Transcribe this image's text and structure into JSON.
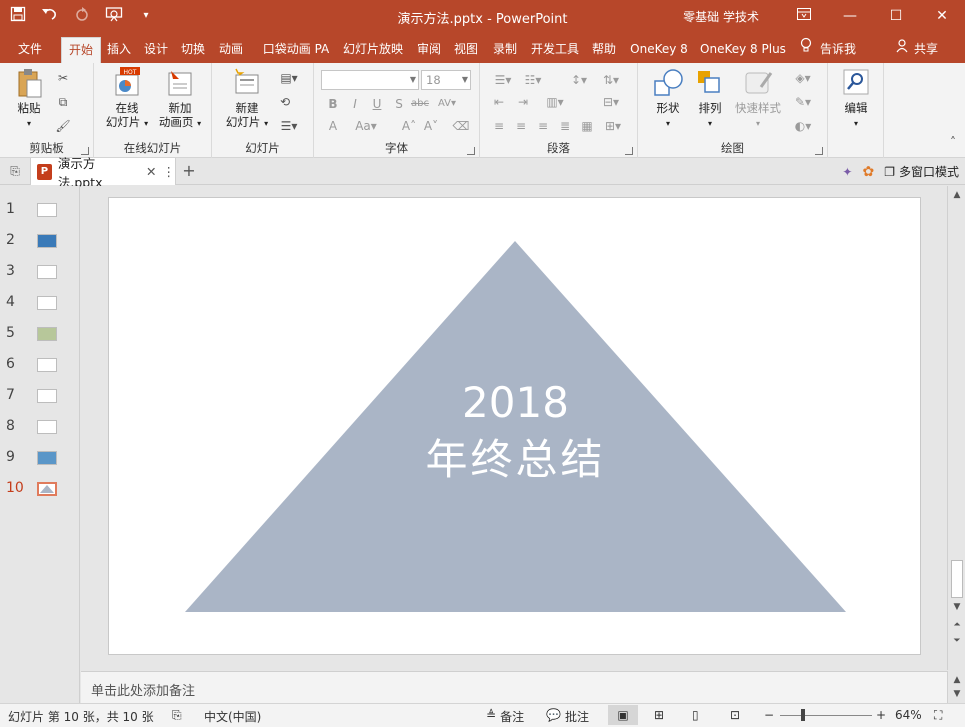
{
  "window": {
    "title": "演示方法.pptx  -  PowerPoint",
    "user": "零基础 学技术",
    "qat_icons": [
      "save-icon",
      "undo-icon",
      "redo-icon",
      "start-from-beginning-icon",
      "customize-qat-icon"
    ]
  },
  "tabs": [
    {
      "label": "文件"
    },
    {
      "label": "开始"
    },
    {
      "label": "插入"
    },
    {
      "label": "设计"
    },
    {
      "label": "切换"
    },
    {
      "label": "动画"
    },
    {
      "label": "口袋动画 PA"
    },
    {
      "label": "幻灯片放映"
    },
    {
      "label": "审阅"
    },
    {
      "label": "视图"
    },
    {
      "label": "录制"
    },
    {
      "label": "开发工具"
    },
    {
      "label": "帮助"
    },
    {
      "label": "OneKey 8"
    },
    {
      "label": "OneKey 8 Plus"
    }
  ],
  "active_tab": "开始",
  "tell_me": "告诉我",
  "share": "共享",
  "ribbon": {
    "clipboard": {
      "label": "剪贴板",
      "paste": "粘贴"
    },
    "online": {
      "label": "在线幻灯片",
      "online_slides_1": "在线",
      "online_slides_2": "幻灯片",
      "anim_1": "新加",
      "anim_2": "动画页",
      "hot": "HOT"
    },
    "slides": {
      "label": "幻灯片",
      "new_1": "新建",
      "new_2": "幻灯片"
    },
    "font": {
      "label": "字体",
      "font_name": "",
      "font_size": "18"
    },
    "paragraph": {
      "label": "段落"
    },
    "drawing": {
      "label": "绘图",
      "shapes": "形状",
      "arrange": "排列",
      "quick_styles": "快速样式"
    },
    "editing": {
      "label": "编辑"
    }
  },
  "document_tab": {
    "name": "演示方法.pptx",
    "multi_window": "多窗口模式"
  },
  "slides_pane": {
    "numbers": [
      "1",
      "2",
      "3",
      "4",
      "5",
      "6",
      "7",
      "8",
      "9",
      "10"
    ],
    "active": "10"
  },
  "slide": {
    "year": "2018",
    "title": "年终总结",
    "triangle_color": "#aab5c6"
  },
  "notes": {
    "placeholder": "单击此处添加备注"
  },
  "status": {
    "slide_info": "幻灯片 第 10 张，共 10 张",
    "language": "中文(中国)",
    "notes": "备注",
    "comments": "批注",
    "zoom": "64%"
  },
  "colors": {
    "accent": "#b7472a"
  }
}
